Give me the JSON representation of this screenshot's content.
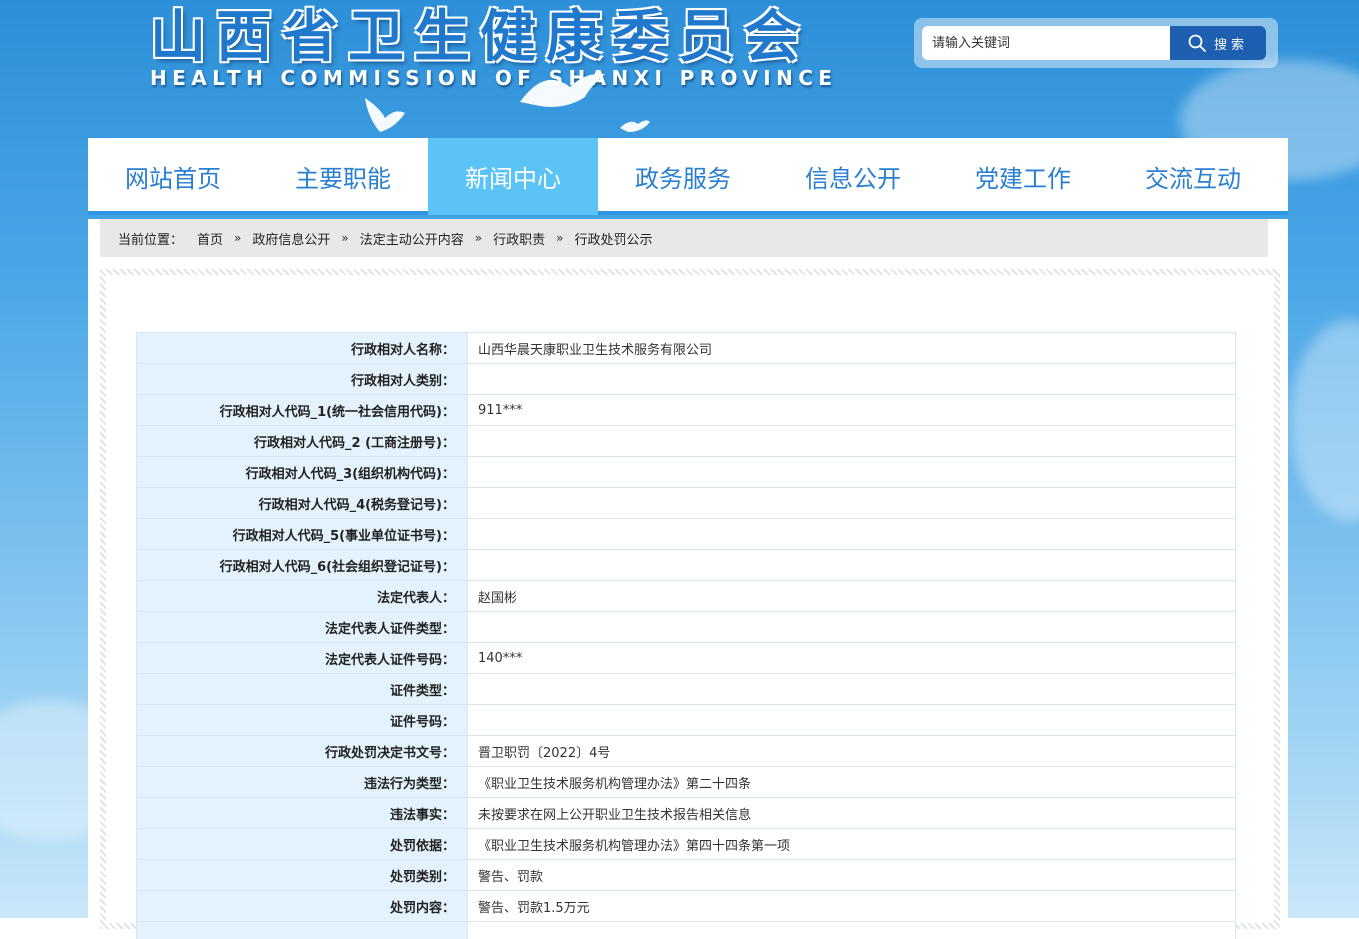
{
  "header": {
    "title": "山西省卫生健康委员会",
    "subtitle": "HEALTH COMMISSION OF SHANXI PROVINCE"
  },
  "search": {
    "placeholder": "请输入关键词",
    "button_label": "搜索",
    "icon": "search-icon"
  },
  "nav": {
    "items": [
      {
        "label": "网站首页",
        "active": false
      },
      {
        "label": "主要职能",
        "active": false
      },
      {
        "label": "新闻中心",
        "active": true
      },
      {
        "label": "政务服务",
        "active": false
      },
      {
        "label": "信息公开",
        "active": false
      },
      {
        "label": "党建工作",
        "active": false
      },
      {
        "label": "交流互动",
        "active": false
      }
    ]
  },
  "breadcrumb": {
    "lead": "当前位置：",
    "separator": "»",
    "items": [
      "首页",
      "政府信息公开",
      "法定主动公开内容",
      "行政职责",
      "行政处罚公示"
    ]
  },
  "record": {
    "rows": [
      {
        "label": "行政相对人名称：",
        "value": "山西华晨天康职业卫生技术服务有限公司"
      },
      {
        "label": "行政相对人类别：",
        "value": ""
      },
      {
        "label": "行政相对人代码_1(统一社会信用代码)：",
        "value": "911***"
      },
      {
        "label": "行政相对人代码_2 (工商注册号)：",
        "value": ""
      },
      {
        "label": "行政相对人代码_3(组织机构代码)：",
        "value": ""
      },
      {
        "label": "行政相对人代码_4(税务登记号)：",
        "value": ""
      },
      {
        "label": "行政相对人代码_5(事业单位证书号)：",
        "value": ""
      },
      {
        "label": "行政相对人代码_6(社会组织登记证号)：",
        "value": ""
      },
      {
        "label": "法定代表人：",
        "value": "赵国彬"
      },
      {
        "label": "法定代表人证件类型：",
        "value": ""
      },
      {
        "label": "法定代表人证件号码：",
        "value": "140***"
      },
      {
        "label": "证件类型：",
        "value": ""
      },
      {
        "label": "证件号码：",
        "value": ""
      },
      {
        "label": "行政处罚决定书文号：",
        "value": "晋卫职罚〔2022〕4号"
      },
      {
        "label": "违法行为类型：",
        "value": "《职业卫生技术服务机构管理办法》第二十四条"
      },
      {
        "label": "违法事实：",
        "value": "未按要求在网上公开职业卫生技术报告相关信息"
      },
      {
        "label": "处罚依据：",
        "value": "《职业卫生技术服务机构管理办法》第四十四条第一项"
      },
      {
        "label": "处罚类别：",
        "value": "警告、罚款"
      },
      {
        "label": "处罚内容：",
        "value": "警告、罚款1.5万元"
      },
      {
        "label": "",
        "value": ""
      }
    ]
  },
  "colors": {
    "nav_text": "#2a7fd0",
    "nav_active_bg": "#5cc3f7",
    "nav_underline": "#2f95e0",
    "search_button": "#1d5fb0",
    "label_bg": "#e3f2fc"
  }
}
